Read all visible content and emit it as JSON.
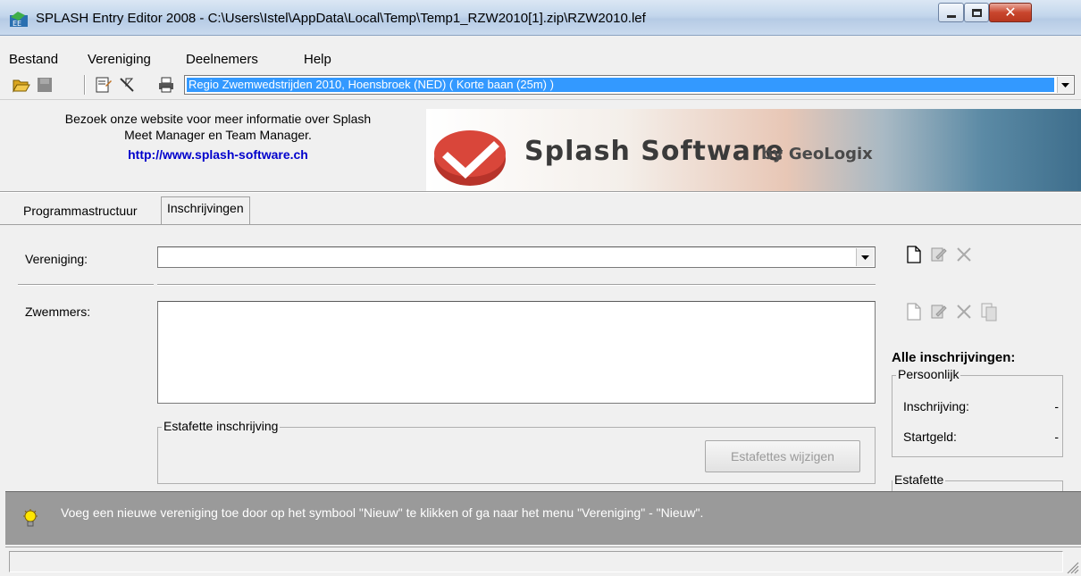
{
  "window": {
    "title": "SPLASH Entry Editor 2008 - C:\\Users\\Istel\\AppData\\Local\\Temp\\Temp1_RZW2010[1].zip\\RZW2010.lef"
  },
  "menu": {
    "items": [
      "Bestand",
      "Vereniging",
      "Deelnemers",
      "Help"
    ]
  },
  "toolbar": {
    "meet_selected": "Regio Zwemwedstrijden 2010,  Hoensbroek  (NED)   ( Korte baan (25m) )"
  },
  "banner": {
    "text_line1": "Bezoek onze website voor meer informatie over Splash",
    "text_line2": "Meet Manager en Team Manager.",
    "link": "http://www.splash-software.ch",
    "logo_name": "Splash Software",
    "logo_by": "by GeoLogix"
  },
  "tabs": [
    "Programmastructuur",
    "Inschrijvingen"
  ],
  "form": {
    "vereniging_label": "Vereniging:",
    "vereniging_value": "",
    "zwemmers_label": "Zwemmers:",
    "estafette_group": "Estafette inschrijving",
    "estafettes_button": "Estafettes wijzigen"
  },
  "summary": {
    "heading": "Alle inschrijvingen:",
    "persoonlijk_group": "Persoonlijk",
    "inschrijving_label": "Inschrijving:",
    "inschrijving_value": "-",
    "startgeld_label": "Startgeld:",
    "startgeld_value": "-",
    "estafette_group": "Estafette"
  },
  "hint": {
    "text": "Voeg een nieuwe vereniging toe door op het symbool \"Nieuw\" te klikken of ga naar het menu \"Vereniging\" - \"Nieuw\"."
  },
  "colors": {
    "selection": "#3399ff",
    "link": "#0000cc",
    "hint_bg": "#9a9a9a"
  }
}
